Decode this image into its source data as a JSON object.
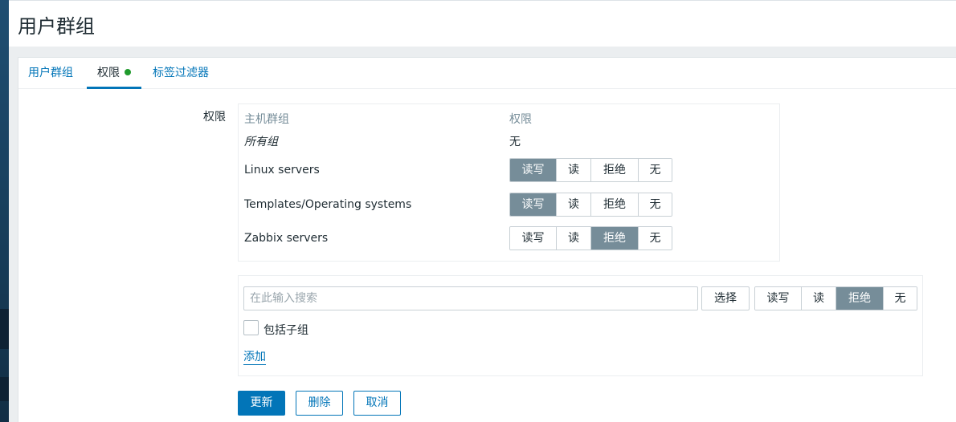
{
  "page": {
    "title": "用户群组"
  },
  "tabs": [
    {
      "label": "用户群组"
    },
    {
      "label": "权限"
    },
    {
      "label": "标签过滤器"
    }
  ],
  "permissions": {
    "field_label": "权限",
    "columns": {
      "host_group": "主机群组",
      "permission": "权限"
    },
    "all_groups": {
      "name": "所有组",
      "value": "无"
    },
    "options": [
      "读写",
      "读",
      "拒绝",
      "无"
    ],
    "rows": [
      {
        "name": "Linux servers",
        "selected": "读写"
      },
      {
        "name": "Templates/Operating systems",
        "selected": "读写"
      },
      {
        "name": "Zabbix servers",
        "selected": "拒绝"
      }
    ]
  },
  "add_section": {
    "search_placeholder": "在此输入搜索",
    "select_label": "选择",
    "selected": "拒绝",
    "include_subgroups_label": "包括子组",
    "add_link": "添加"
  },
  "buttons": {
    "update": "更新",
    "delete": "删除",
    "cancel": "取消"
  },
  "colors": {
    "accent": "#0275b8",
    "selected_option": "#768d99",
    "active_dot": "#1f9a2c"
  }
}
